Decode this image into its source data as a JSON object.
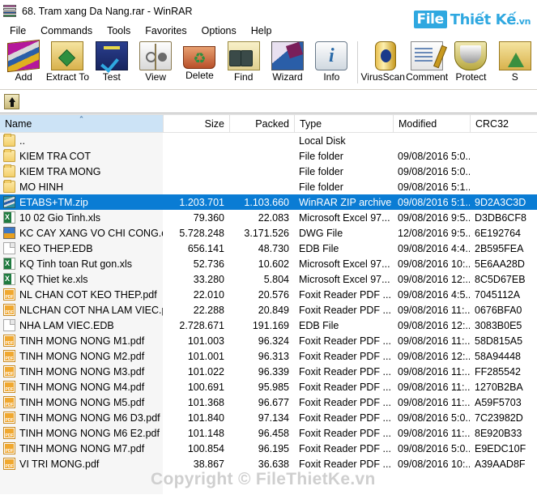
{
  "window": {
    "title": "68. Tram xang Da Nang.rar - WinRAR",
    "app_icon": "winrar-books-icon"
  },
  "brand": {
    "part1": "File",
    "part2": "Thiết Kế",
    "part3": ".vn"
  },
  "menubar": {
    "items": [
      {
        "label": "File"
      },
      {
        "label": "Commands"
      },
      {
        "label": "Tools"
      },
      {
        "label": "Favorites"
      },
      {
        "label": "Options"
      },
      {
        "label": "Help"
      }
    ]
  },
  "toolbar": {
    "buttons": [
      {
        "label": "Add",
        "icon": "add-archive-icon",
        "cls": "ic-add"
      },
      {
        "label": "Extract To",
        "icon": "extract-to-icon",
        "cls": "ic-extract"
      },
      {
        "label": "Test",
        "icon": "test-archive-icon",
        "cls": "ic-test"
      },
      {
        "label": "View",
        "icon": "view-file-icon",
        "cls": "ic-view"
      },
      {
        "label": "Delete",
        "icon": "delete-icon",
        "cls": "ic-delete"
      },
      {
        "label": "Find",
        "icon": "find-binoculars-icon",
        "cls": "ic-find"
      },
      {
        "label": "Wizard",
        "icon": "wizard-icon",
        "cls": "ic-wizard"
      },
      {
        "label": "Info",
        "icon": "info-icon",
        "cls": "ic-info"
      }
    ],
    "buttons2": [
      {
        "label": "VirusScan",
        "icon": "virus-scan-icon",
        "cls": "ic-virus"
      },
      {
        "label": "Comment",
        "icon": "comment-icon",
        "cls": "ic-comment"
      },
      {
        "label": "Protect",
        "icon": "protect-shield-icon",
        "cls": "ic-protect"
      },
      {
        "label": "S",
        "icon": "sfx-icon",
        "cls": "ic-sfx"
      }
    ]
  },
  "pathbar": {
    "up_icon": "up-one-level-icon",
    "path_value": "",
    "path_placeholder": ""
  },
  "list": {
    "columns": [
      {
        "key": "name",
        "label": "Name",
        "sorted": true,
        "sort_arrow": "⌃"
      },
      {
        "key": "size",
        "label": "Size",
        "sorted": false
      },
      {
        "key": "packed",
        "label": "Packed",
        "sorted": false
      },
      {
        "key": "type",
        "label": "Type",
        "sorted": false
      },
      {
        "key": "mod",
        "label": "Modified",
        "sorted": false
      },
      {
        "key": "crc",
        "label": "CRC32",
        "sorted": false
      }
    ],
    "rows": [
      {
        "icon": "folder",
        "name": "..",
        "size": "",
        "packed": "",
        "type": "Local Disk",
        "mod": "",
        "crc": "",
        "selected": false
      },
      {
        "icon": "folder",
        "name": "KIEM TRA COT",
        "size": "",
        "packed": "",
        "type": "File folder",
        "mod": "09/08/2016 5:0...",
        "crc": "",
        "selected": false
      },
      {
        "icon": "folder",
        "name": "KIEM TRA MONG",
        "size": "",
        "packed": "",
        "type": "File folder",
        "mod": "09/08/2016 5:0...",
        "crc": "",
        "selected": false
      },
      {
        "icon": "folder",
        "name": "MO HINH",
        "size": "",
        "packed": "",
        "type": "File folder",
        "mod": "09/08/2016 5:1...",
        "crc": "",
        "selected": false
      },
      {
        "icon": "zip",
        "name": "ETABS+TM.zip",
        "size": "1.203.701",
        "packed": "1.103.660",
        "type": "WinRAR ZIP archive",
        "mod": "09/08/2016 5:1...",
        "crc": "9D2A3C3D",
        "selected": true
      },
      {
        "icon": "xls",
        "name": "10 02 Gio Tinh.xls",
        "size": "79.360",
        "packed": "22.083",
        "type": "Microsoft Excel 97...",
        "mod": "09/08/2016 9:5...",
        "crc": "D3DB6CF8",
        "selected": false
      },
      {
        "icon": "dwg",
        "name": "KC CAY XANG VO CHI CONG.dwg",
        "size": "5.728.248",
        "packed": "3.171.526",
        "type": "DWG File",
        "mod": "12/08/2016 9:5...",
        "crc": "6E192764",
        "selected": false
      },
      {
        "icon": "edb",
        "name": "KEO THEP.EDB",
        "size": "656.141",
        "packed": "48.730",
        "type": "EDB File",
        "mod": "09/08/2016 4:4...",
        "crc": "2B595FEA",
        "selected": false
      },
      {
        "icon": "xls",
        "name": "KQ Tinh toan Rut gon.xls",
        "size": "52.736",
        "packed": "10.602",
        "type": "Microsoft Excel 97...",
        "mod": "09/08/2016 10:...",
        "crc": "5E6AA28D",
        "selected": false
      },
      {
        "icon": "xls",
        "name": "KQ Thiet ke.xls",
        "size": "33.280",
        "packed": "5.804",
        "type": "Microsoft Excel 97...",
        "mod": "09/08/2016 12:...",
        "crc": "8C5D67EB",
        "selected": false
      },
      {
        "icon": "pdf",
        "name": "NL CHAN COT KEO THEP.pdf",
        "size": "22.010",
        "packed": "20.576",
        "type": "Foxit Reader PDF ...",
        "mod": "09/08/2016 4:5...",
        "crc": "7045112A",
        "selected": false
      },
      {
        "icon": "pdf",
        "name": "NLCHAN COT NHA LAM VIEC.pdf",
        "size": "22.288",
        "packed": "20.849",
        "type": "Foxit Reader PDF ...",
        "mod": "09/08/2016 11:...",
        "crc": "0676BFA0",
        "selected": false
      },
      {
        "icon": "edb",
        "name": "NHA LAM VIEC.EDB",
        "size": "2.728.671",
        "packed": "191.169",
        "type": "EDB File",
        "mod": "09/08/2016 12:...",
        "crc": "3083B0E5",
        "selected": false
      },
      {
        "icon": "pdf",
        "name": "TINH MONG NONG M1.pdf",
        "size": "101.003",
        "packed": "96.324",
        "type": "Foxit Reader PDF ...",
        "mod": "09/08/2016 11:...",
        "crc": "58D815A5",
        "selected": false
      },
      {
        "icon": "pdf",
        "name": "TINH MONG NONG M2.pdf",
        "size": "101.001",
        "packed": "96.313",
        "type": "Foxit Reader PDF ...",
        "mod": "09/08/2016 12:...",
        "crc": "58A94448",
        "selected": false
      },
      {
        "icon": "pdf",
        "name": "TINH MONG NONG M3.pdf",
        "size": "101.022",
        "packed": "96.339",
        "type": "Foxit Reader PDF ...",
        "mod": "09/08/2016 11:...",
        "crc": "FF285542",
        "selected": false
      },
      {
        "icon": "pdf",
        "name": "TINH MONG NONG M4.pdf",
        "size": "100.691",
        "packed": "95.985",
        "type": "Foxit Reader PDF ...",
        "mod": "09/08/2016 11:...",
        "crc": "1270B2BA",
        "selected": false
      },
      {
        "icon": "pdf",
        "name": "TINH MONG NONG M5.pdf",
        "size": "101.368",
        "packed": "96.677",
        "type": "Foxit Reader PDF ...",
        "mod": "09/08/2016 11:...",
        "crc": "A59F5703",
        "selected": false
      },
      {
        "icon": "pdf",
        "name": "TINH MONG NONG M6 D3.pdf",
        "size": "101.840",
        "packed": "97.134",
        "type": "Foxit Reader PDF ...",
        "mod": "09/08/2016 5:0...",
        "crc": "7C23982D",
        "selected": false
      },
      {
        "icon": "pdf",
        "name": "TINH MONG NONG M6 E2.pdf",
        "size": "101.148",
        "packed": "96.458",
        "type": "Foxit Reader PDF ...",
        "mod": "09/08/2016 11:...",
        "crc": "8E920B33",
        "selected": false
      },
      {
        "icon": "pdf",
        "name": "TINH MONG NONG M7.pdf",
        "size": "100.854",
        "packed": "96.195",
        "type": "Foxit Reader PDF ...",
        "mod": "09/08/2016 5:0...",
        "crc": "E9EDC10F",
        "selected": false
      },
      {
        "icon": "pdf",
        "name": "VI TRI MONG.pdf",
        "size": "38.867",
        "packed": "36.638",
        "type": "Foxit Reader PDF ...",
        "mod": "09/08/2016 10:...",
        "crc": "A39AAD8F",
        "selected": false
      }
    ]
  },
  "watermark": {
    "text": "Copyright © FileThietKe.vn"
  },
  "colors": {
    "selection_blue": "#0a7cd4",
    "header_sort_blue": "#cce3f6",
    "brand_blue": "#2fa8e0",
    "name_column_tint": "#f6f6f6"
  }
}
